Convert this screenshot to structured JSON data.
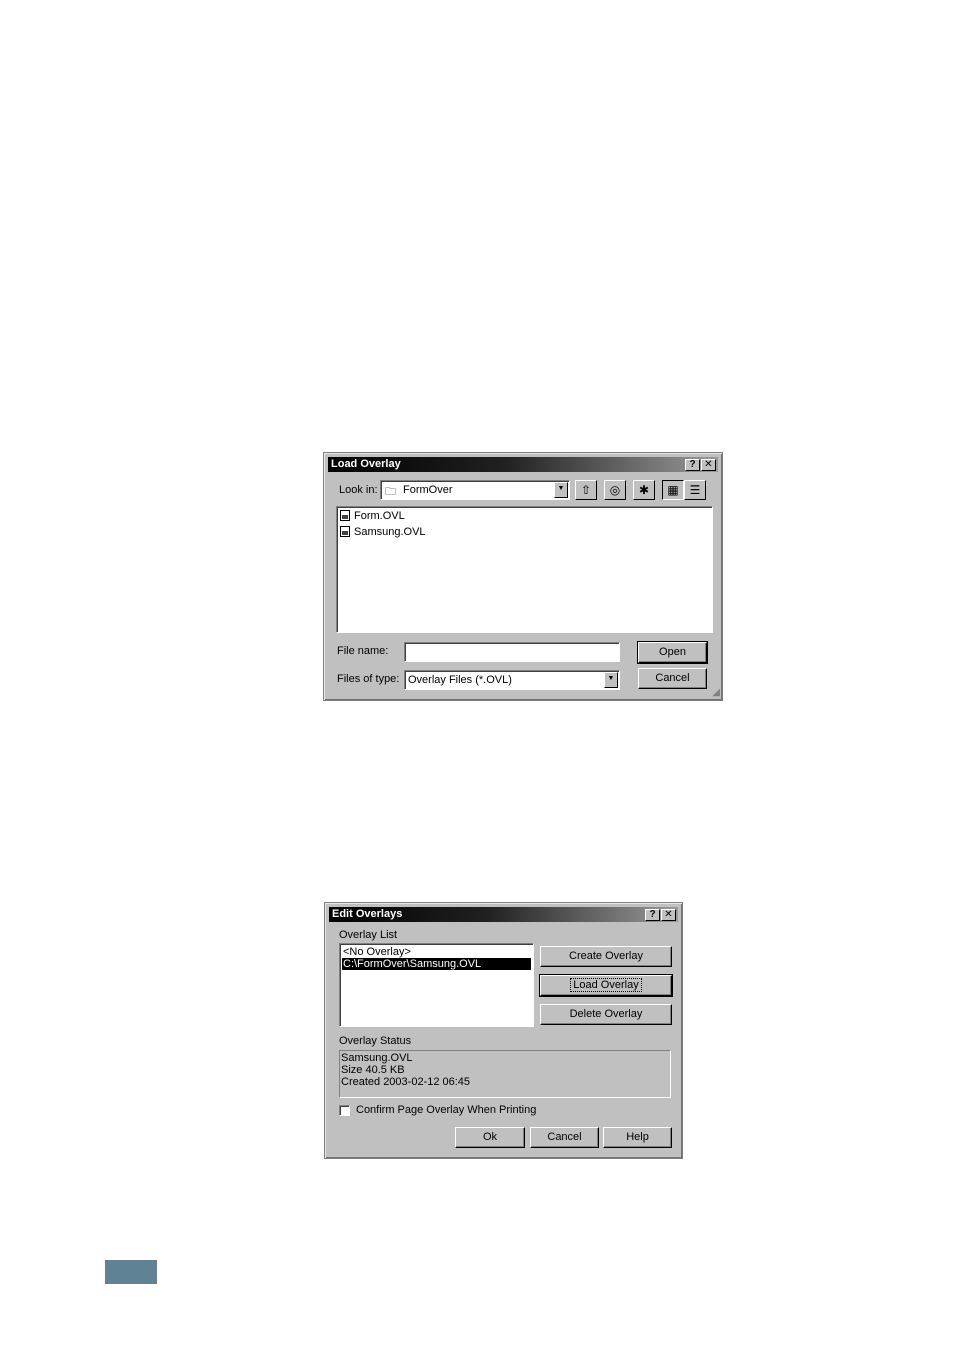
{
  "load_dialog": {
    "title": "Load Overlay",
    "help_btn": "?",
    "close_btn": "✕",
    "look_in_label": "Look in:",
    "look_in_value": "FormOver",
    "toolbar_icons": [
      "up-folder-icon",
      "desktop-icon",
      "new-folder-icon",
      "list-view-icon",
      "details-view-icon"
    ],
    "files": [
      {
        "name": "Form.OVL"
      },
      {
        "name": "Samsung.OVL"
      }
    ],
    "file_name_label": "File name:",
    "file_name_value": "",
    "files_of_type_label": "Files of type:",
    "files_of_type_value": "Overlay Files (*.OVL)",
    "open_label": "Open",
    "cancel_label": "Cancel"
  },
  "edit_dialog": {
    "title": "Edit Overlays",
    "help_btn": "?",
    "close_btn": "✕",
    "overlay_list_label": "Overlay List",
    "overlay_list": [
      {
        "label": "<No Overlay>",
        "selected": false
      },
      {
        "label": "C:\\FormOver\\Samsung.OVL",
        "selected": true
      }
    ],
    "create_label": "Create Overlay",
    "load_label": "Load Overlay",
    "delete_label": "Delete Overlay",
    "status_label": "Overlay Status",
    "status_lines": [
      "Samsung.OVL",
      "Size 40.5 KB",
      "Created 2003-02-12 06:45"
    ],
    "confirm_label": "Confirm Page Overlay When Printing",
    "confirm_checked": false,
    "ok_label": "Ok",
    "cancel_label": "Cancel",
    "help_label": "Help"
  }
}
